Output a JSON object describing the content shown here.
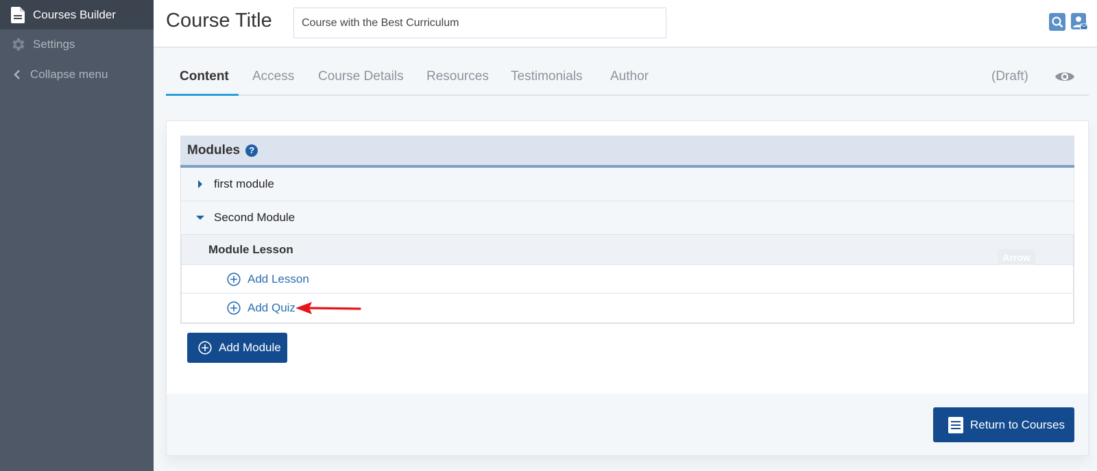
{
  "sidebar": {
    "items": [
      {
        "label": "Courses Builder",
        "icon": "document-icon"
      },
      {
        "label": "Settings",
        "icon": "gear-icon"
      },
      {
        "label": "Collapse menu",
        "icon": "chevron-left-icon"
      }
    ]
  },
  "header": {
    "title": "Course Title",
    "course_title_value": "Course with the Best Curriculum"
  },
  "tabs": [
    {
      "label": "Content"
    },
    {
      "label": "Access"
    },
    {
      "label": "Course Details"
    },
    {
      "label": "Resources"
    },
    {
      "label": "Testimonials"
    },
    {
      "label": "Author"
    }
  ],
  "status": "(Draft)",
  "modules": {
    "heading": "Modules",
    "help_glyph": "?",
    "items": [
      {
        "label": "first module",
        "state": "collapsed"
      },
      {
        "label": "Second Module",
        "state": "expanded"
      }
    ],
    "lesson_section": {
      "heading": "Module Lesson",
      "tooltip": "Arrow",
      "actions": [
        {
          "label": "Add Lesson"
        },
        {
          "label": "Add Quiz"
        }
      ]
    },
    "add_module_label": "Add Module"
  },
  "footer": {
    "return_label": "Return to Courses"
  },
  "colors": {
    "sidebar_bg": "#4e5866",
    "primary_button": "#144b8f",
    "link": "#2a6fb0",
    "tab_active_underline": "#2a9fd8",
    "annotation_arrow": "#e8141b"
  }
}
